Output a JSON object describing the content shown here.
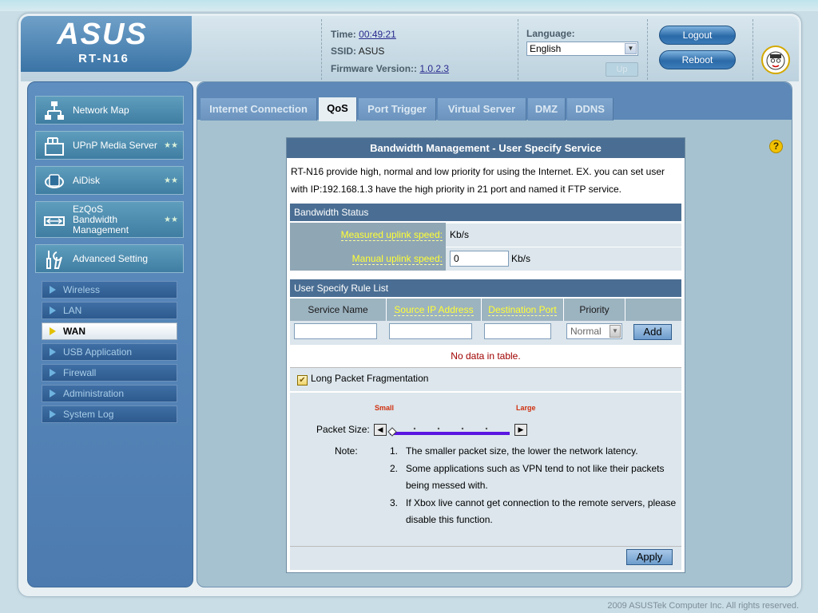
{
  "header": {
    "brand": "ASUS",
    "model": "RT-N16",
    "time_label": "Time:",
    "time_value": "00:49:21",
    "ssid_label": "SSID:",
    "ssid_value": "ASUS",
    "fw_label": "Firmware Version::",
    "fw_value": "1.0.2.3",
    "language_label": "Language:",
    "language_value": "English",
    "up_label": "Up",
    "logout_label": "Logout",
    "reboot_label": "Reboot"
  },
  "sidebar": {
    "items": [
      {
        "label": "Network Map",
        "icon": "network-map-icon"
      },
      {
        "label": "UPnP Media Server",
        "icon": "media-server-icon"
      },
      {
        "label": "AiDisk",
        "icon": "aidisk-icon"
      },
      {
        "label": "EzQoS Bandwidth Management",
        "line1": "EzQoS",
        "line2": "Bandwidth",
        "line3": "Management",
        "icon": "ezqos-icon"
      },
      {
        "label": "Advanced Setting",
        "icon": "tools-icon"
      }
    ],
    "subitems": [
      "Wireless",
      "LAN",
      "WAN",
      "USB Application",
      "Firewall",
      "Administration",
      "System Log"
    ],
    "active_subitem": "WAN"
  },
  "tabs": [
    "Internet Connection",
    "QoS",
    "Port Trigger",
    "Virtual Server",
    "DMZ",
    "DDNS"
  ],
  "active_tab": "QoS",
  "panel": {
    "title": "Bandwidth Management - User Specify Service",
    "description": "RT-N16 provide high, normal and low priority for using the Internet. EX. you can set user with IP:192.168.1.3 have the high priority in 21 port and named it FTP service.",
    "bandwidth_status": {
      "heading": "Bandwidth Status",
      "measured_label": "Measured uplink speed:",
      "measured_unit": "Kb/s",
      "manual_label": "Manual uplink speed:",
      "manual_value": "0",
      "manual_unit": "Kb/s"
    },
    "rule_list": {
      "heading": "User Specify Rule List",
      "columns": [
        "Service Name",
        "Source IP Address",
        "Destination Port",
        "Priority"
      ],
      "priority_value": "Normal",
      "add_label": "Add",
      "empty_message": "No data in table."
    },
    "fragmentation": {
      "label": "Long Packet Fragmentation",
      "checked": true,
      "small_label": "Small",
      "large_label": "Large",
      "packet_size_label": "Packet Size:",
      "slider_level_fraction": 0.0
    },
    "notes": {
      "label": "Note:",
      "items": [
        {
          "num": "1.",
          "text": "The smaller packet size, the lower the network latency."
        },
        {
          "num": "2.",
          "text": "Some applications such as VPN tend to not like their packets being messed with."
        },
        {
          "num": "3.",
          "text": "If Xbox live cannot get connection to the remote servers, please disable this function."
        }
      ]
    },
    "apply_label": "Apply"
  },
  "footer": {
    "copyright": "2009 ASUSTek Computer Inc. All rights reserved."
  },
  "colors": {
    "accent": "#4a6e93",
    "link_yellow": "#ffff33",
    "error_red": "#a00000"
  }
}
